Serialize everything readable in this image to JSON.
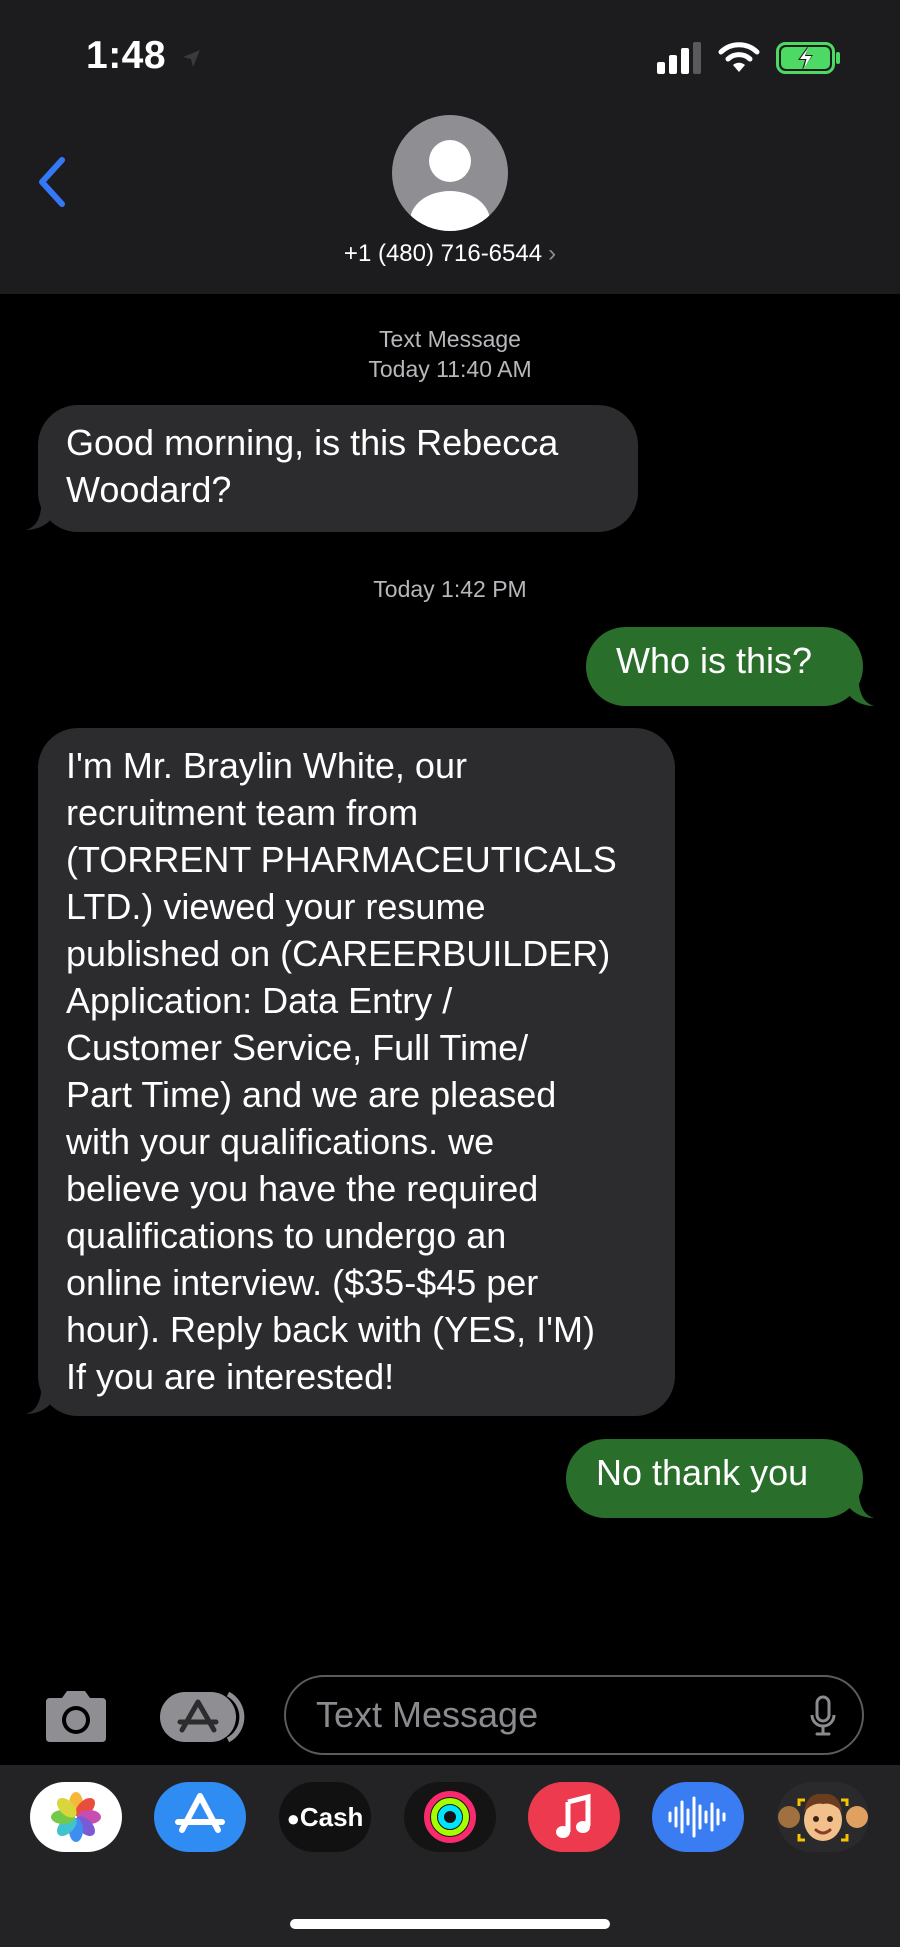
{
  "status_bar": {
    "time": "1:48"
  },
  "header": {
    "contact": "+1 (480) 716-6544",
    "chevron": "›"
  },
  "thread": {
    "meta1_label": "Text Message",
    "meta1_time": "Today 11:40 AM",
    "msg1": [
      "Good morning, is this Rebecca",
      "Woodard?"
    ],
    "meta2_time": "Today 1:42 PM",
    "msg2": "Who is this?",
    "msg3": [
      "I'm Mr. Braylin White, our",
      "recruitment team from",
      "(TORRENT PHARMACEUTICALS",
      "LTD.) viewed your resume",
      "published on (CAREERBUILDER)",
      "Application: Data Entry /",
      "Customer Service, Full Time/",
      "Part Time) and we are pleased",
      "with your qualifications. we",
      "believe you have the required",
      "qualifications to undergo an",
      "online interview. ($35-$45 per",
      "hour). Reply back with (YES, I'M)",
      "If you are interested!"
    ],
    "msg4": "No thank you"
  },
  "compose": {
    "placeholder": "Text Message"
  },
  "apps": {
    "cash_label": "Cash",
    "items": [
      "photos",
      "app-store",
      "apple-cash",
      "activity",
      "music",
      "voice-memos",
      "memoji"
    ]
  },
  "colors": {
    "header_bg": "#1c1c1e",
    "incoming_bubble": "#2c2c2e",
    "outgoing_bubble": "#2a6e2b",
    "accent_blue": "#3478f6",
    "battery_green": "#4cd964"
  }
}
